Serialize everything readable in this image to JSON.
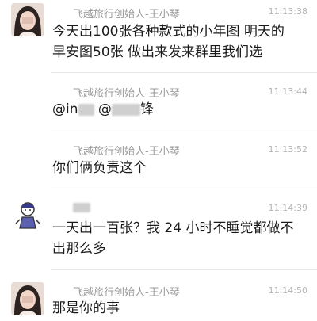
{
  "messages": [
    {
      "sender": "飞越旅行创始人-王小琴",
      "time": "11:13:38",
      "lines": [
        "今天出100张各种款式的小年图 明天的",
        "早安图50张 做出来发来群里我们选"
      ]
    },
    {
      "sender": "飞越旅行创始人-王小琴",
      "time": "11:13:44",
      "mention_prefix": "@in",
      "mention_mid": " @",
      "mention_suffix": "锋"
    },
    {
      "sender": "飞越旅行创始人-王小琴",
      "time": "11:13:52",
      "lines": [
        "你们俩负责这个"
      ]
    },
    {
      "sender": "",
      "time": "11:14:39",
      "lines": [
        "一天出一百张？我 24 小时不睡觉都做不",
        "出那么多"
      ]
    },
    {
      "sender": "飞越旅行创始人-王小琴",
      "time": "11:14:50",
      "lines": [
        "那是你的事"
      ]
    }
  ],
  "icons": {
    "avatar_sender": "girl-portrait-avatar",
    "avatar_user": "cartoon-character-avatar"
  }
}
